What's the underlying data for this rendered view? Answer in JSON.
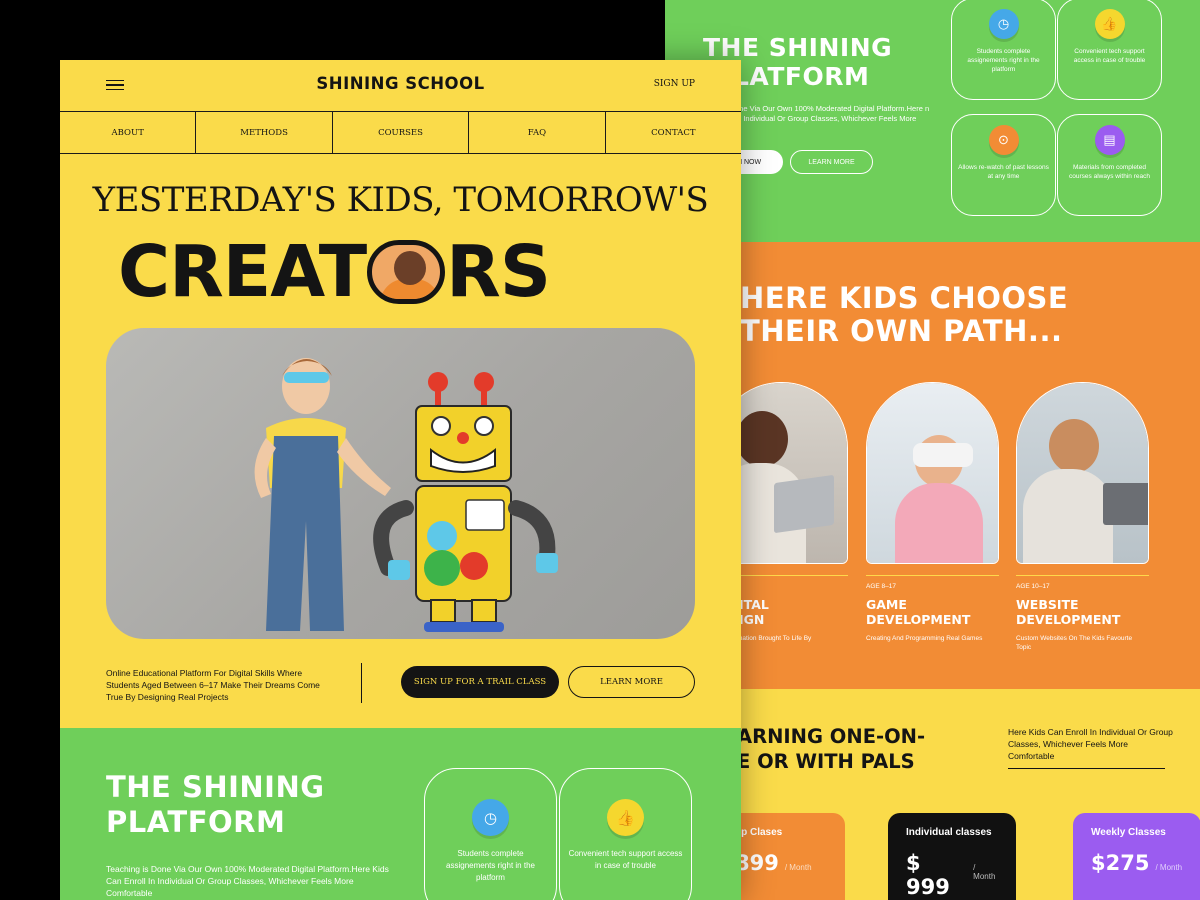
{
  "front": {
    "logo": "SHINING SCHOOL",
    "signup": "SIGN UP",
    "nav": [
      "ABOUT",
      "METHODS",
      "COURSES",
      "FAQ",
      "CONTACT"
    ],
    "headline_top": "YESTERDAY'S KIDS, TOMORROW'S",
    "headline_pre": "CREAT",
    "headline_post": "RS",
    "description": "Online Educational Platform For Digital Skills Where Students Aged Between 6–17 Make Their Dreams Come True By Designing Real Projects",
    "cta_primary": "SIGN UP FOR A TRAIL CLASS",
    "cta_secondary": "LEARN MORE",
    "platform": {
      "title_line1": "THE SHINING",
      "title_line2": "PLATFORM",
      "text": "Teaching is Done Via Our Own 100% Moderated Digital Platform.Here Kids Can Enroll In Individual Or Group Classes, Whichever Feels More Comfortable",
      "features": [
        {
          "icon": "clock-icon",
          "text": "Students complete assignements right in the platform",
          "color": "#45a8e8"
        },
        {
          "icon": "thumbs-up-icon",
          "text": "Convenient tech support access in case of trouble",
          "color": "#f5d72e"
        }
      ]
    }
  },
  "back": {
    "platform": {
      "title_line1": "THE SHINING",
      "title_line2": "LATFORM",
      "text": "one Via Our Own 100% Moderated Digital Platform.Here n In Individual Or Group Classes, Whichever Feels More",
      "btn_primary": "N NOW",
      "btn_secondary": "LEARN MORE",
      "features": [
        {
          "icon": "clock-icon",
          "text": "Students complete assignements right in the platform",
          "color": "#45a8e8"
        },
        {
          "icon": "thumbs-up-icon",
          "text": "Convenient tech support access in case of trouble",
          "color": "#f5d72e"
        },
        {
          "icon": "location-pin-icon",
          "text": "Allows re-watch of past lessons at any time",
          "color": "#f28c35"
        },
        {
          "icon": "folder-icon",
          "text": "Materials from completed courses always within reach",
          "color": "#9b5cf0"
        }
      ]
    },
    "paths": {
      "title_line1": "HERE KIDS CHOOSE",
      "title_line2": "THEIR OWN PATH...",
      "courses": [
        {
          "age": "",
          "title_line1": "ITAL",
          "title_line2": "IGN",
          "desc": "mation Brought To Life By"
        },
        {
          "age": "AGE 8–17",
          "title_line1": "GAME",
          "title_line2": "DEVELOPMENT",
          "desc": "Creating And Programming Real Games"
        },
        {
          "age": "AGE 10–17",
          "title_line1": "WEBSITE",
          "title_line2": "DEVELOPMENT",
          "desc": "Custom Websites On The Kids Favourte Topic"
        }
      ]
    },
    "learning": {
      "title_line1": "ARNING ONE-ON-",
      "title_line2": "E OR WITH PALS",
      "text": "Here Kids Can Enroll In Individual Or Group Classes, Whichever Feels More Comfortable",
      "prices": [
        {
          "name": "up Clases",
          "value": "899",
          "unit": "/ Month",
          "color": "#f28c35"
        },
        {
          "name": "Individual classes",
          "value": "$ 999",
          "unit": "/ Month",
          "color": "#111111"
        },
        {
          "name": "Weekly Classes",
          "value": "$275",
          "unit": "/ Month",
          "color": "#9b5cf0"
        }
      ]
    }
  }
}
